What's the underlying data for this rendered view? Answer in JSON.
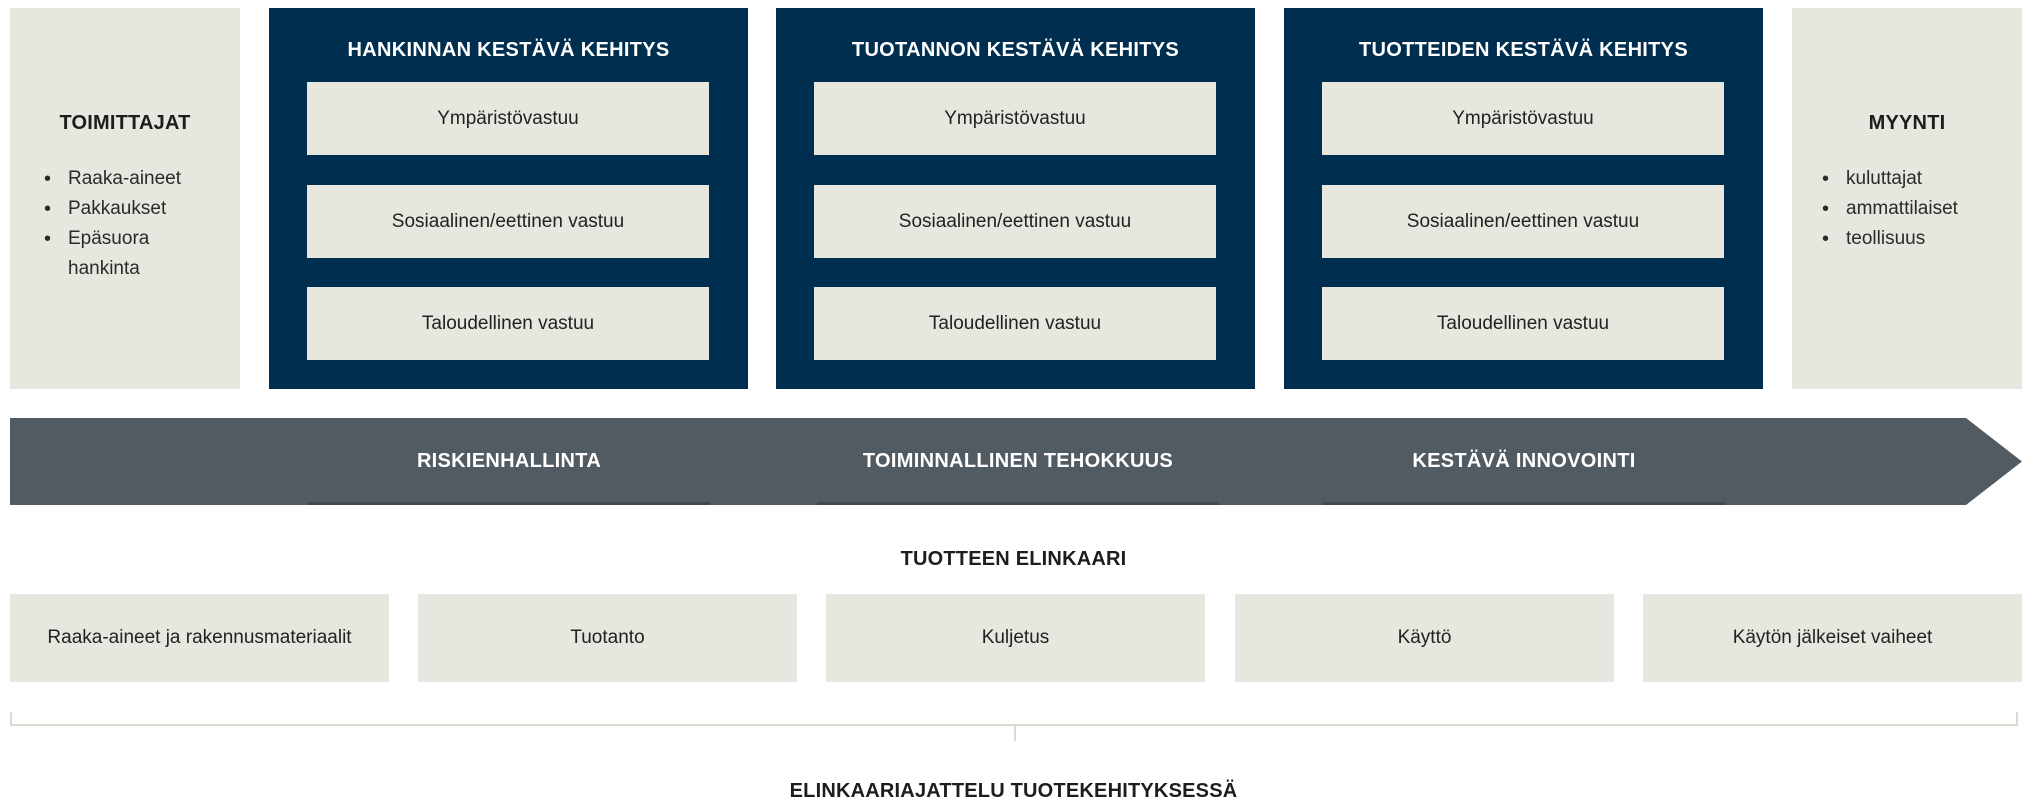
{
  "suppliers": {
    "title": "TOIMITTAJAT",
    "items": [
      "Raaka-aineet",
      "Pakkaukset",
      "Epäsuora",
      "hankinta"
    ]
  },
  "sales": {
    "title": "MYYNTI",
    "items": [
      "kuluttajat",
      "ammattilaiset",
      "teollisuus"
    ]
  },
  "columns": [
    {
      "title": "HANKINNAN KESTÄVÄ KEHITYS",
      "cards": [
        "Ympäristövastuu",
        "Sosiaalinen/eettinen vastuu",
        "Taloudellinen vastuu"
      ]
    },
    {
      "title": "TUOTANNON KESTÄVÄ KEHITYS",
      "cards": [
        "Ympäristövastuu",
        "Sosiaalinen/eettinen vastuu",
        "Taloudellinen vastuu"
      ]
    },
    {
      "title": "TUOTTEIDEN KESTÄVÄ KEHITYS",
      "cards": [
        "Ympäristövastuu",
        "Sosiaalinen/eettinen vastuu",
        "Taloudellinen vastuu"
      ]
    }
  ],
  "arrow": {
    "labels": [
      "RISKIENHALLINTA",
      "TOIMINNALLINEN TEHOKKUUS",
      "KESTÄVÄ INNOVOINTI"
    ]
  },
  "lifecycle": {
    "title": "TUOTTEEN ELINKAARI",
    "stages": [
      "Raaka-aineet ja rakennusmateriaalit",
      "Tuotanto",
      "Kuljetus",
      "Käyttö",
      "Käytön jälkeiset vaiheet"
    ]
  },
  "footer": {
    "title": "ELINKAARIAJATTELU TUOTEKEHITYKSESSÄ"
  },
  "colors": {
    "navy": "#002e4f",
    "arrow": "#535b62",
    "beige": "#e7e6df"
  }
}
